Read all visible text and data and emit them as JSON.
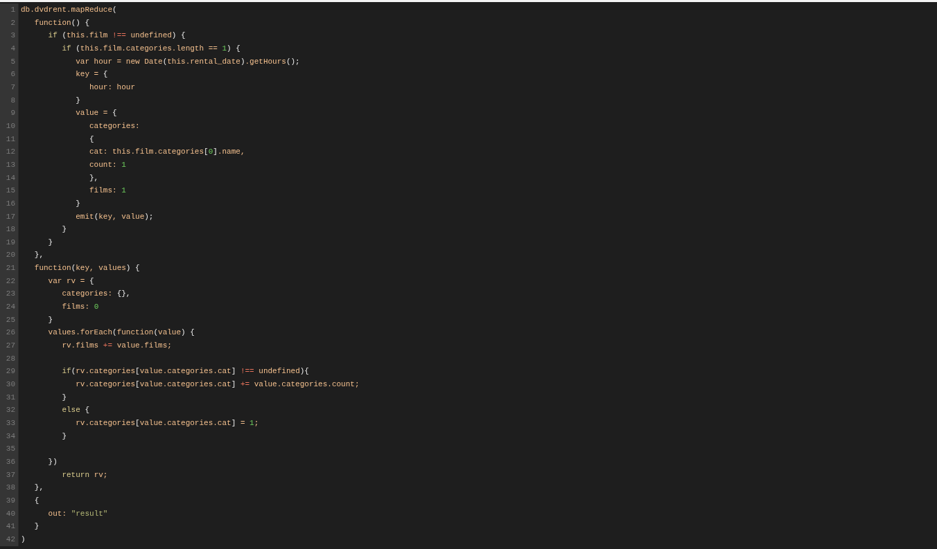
{
  "editor": {
    "lines": [
      {
        "number": "1",
        "tokens": [
          {
            "kind": "t",
            "text": "db.dvdrent.mapReduce"
          },
          {
            "kind": "p",
            "text": "("
          }
        ]
      },
      {
        "number": "2",
        "tokens": [
          {
            "kind": "t",
            "text": "   function"
          },
          {
            "kind": "p",
            "text": "() {"
          }
        ]
      },
      {
        "number": "3",
        "tokens": [
          {
            "kind": "k",
            "text": "      if"
          },
          {
            "kind": "p",
            "text": " ("
          },
          {
            "kind": "t",
            "text": "this.film "
          },
          {
            "kind": "o",
            "text": "!=="
          },
          {
            "kind": "t",
            "text": " undefined"
          },
          {
            "kind": "p",
            "text": ") {"
          }
        ]
      },
      {
        "number": "4",
        "tokens": [
          {
            "kind": "k",
            "text": "         if"
          },
          {
            "kind": "p",
            "text": " ("
          },
          {
            "kind": "t",
            "text": "this.film.categories.length == "
          },
          {
            "kind": "n",
            "text": "1"
          },
          {
            "kind": "p",
            "text": ") {"
          }
        ]
      },
      {
        "number": "5",
        "tokens": [
          {
            "kind": "t",
            "text": "            var hour = new Date"
          },
          {
            "kind": "p",
            "text": "("
          },
          {
            "kind": "t",
            "text": "this.rental_date"
          },
          {
            "kind": "p",
            "text": ")"
          },
          {
            "kind": "t",
            "text": ".getHours"
          },
          {
            "kind": "p",
            "text": "();"
          }
        ]
      },
      {
        "number": "6",
        "tokens": [
          {
            "kind": "t",
            "text": "            key = "
          },
          {
            "kind": "p",
            "text": "{"
          }
        ]
      },
      {
        "number": "7",
        "tokens": [
          {
            "kind": "t",
            "text": "               hour: hour"
          }
        ]
      },
      {
        "number": "8",
        "tokens": [
          {
            "kind": "p",
            "text": "            }"
          }
        ]
      },
      {
        "number": "9",
        "tokens": [
          {
            "kind": "t",
            "text": "            value = "
          },
          {
            "kind": "p",
            "text": "{"
          }
        ]
      },
      {
        "number": "10",
        "tokens": [
          {
            "kind": "t",
            "text": "               categories:"
          }
        ]
      },
      {
        "number": "11",
        "tokens": [
          {
            "kind": "p",
            "text": "               {"
          }
        ]
      },
      {
        "number": "12",
        "tokens": [
          {
            "kind": "t",
            "text": "               cat: this.film.categories"
          },
          {
            "kind": "p",
            "text": "["
          },
          {
            "kind": "n",
            "text": "0"
          },
          {
            "kind": "p",
            "text": "]"
          },
          {
            "kind": "t",
            "text": ".name,"
          }
        ]
      },
      {
        "number": "13",
        "tokens": [
          {
            "kind": "t",
            "text": "               count: "
          },
          {
            "kind": "n",
            "text": "1"
          }
        ]
      },
      {
        "number": "14",
        "tokens": [
          {
            "kind": "p",
            "text": "               },"
          }
        ]
      },
      {
        "number": "15",
        "tokens": [
          {
            "kind": "t",
            "text": "               films: "
          },
          {
            "kind": "n",
            "text": "1"
          }
        ]
      },
      {
        "number": "16",
        "tokens": [
          {
            "kind": "p",
            "text": "            }"
          }
        ]
      },
      {
        "number": "17",
        "tokens": [
          {
            "kind": "t",
            "text": "            emit"
          },
          {
            "kind": "p",
            "text": "("
          },
          {
            "kind": "t",
            "text": "key, value"
          },
          {
            "kind": "p",
            "text": ");"
          }
        ]
      },
      {
        "number": "18",
        "tokens": [
          {
            "kind": "p",
            "text": "         }"
          }
        ]
      },
      {
        "number": "19",
        "tokens": [
          {
            "kind": "p",
            "text": "      }"
          }
        ]
      },
      {
        "number": "20",
        "tokens": [
          {
            "kind": "p",
            "text": "   },"
          }
        ]
      },
      {
        "number": "21",
        "tokens": [
          {
            "kind": "t",
            "text": "   function"
          },
          {
            "kind": "p",
            "text": "("
          },
          {
            "kind": "t",
            "text": "key, values"
          },
          {
            "kind": "p",
            "text": ") {"
          }
        ]
      },
      {
        "number": "22",
        "tokens": [
          {
            "kind": "t",
            "text": "      var rv = "
          },
          {
            "kind": "p",
            "text": "{"
          }
        ]
      },
      {
        "number": "23",
        "tokens": [
          {
            "kind": "t",
            "text": "         categories: "
          },
          {
            "kind": "p",
            "text": "{},"
          }
        ]
      },
      {
        "number": "24",
        "tokens": [
          {
            "kind": "t",
            "text": "         films: "
          },
          {
            "kind": "n",
            "text": "0"
          }
        ]
      },
      {
        "number": "25",
        "tokens": [
          {
            "kind": "p",
            "text": "      }"
          }
        ]
      },
      {
        "number": "26",
        "tokens": [
          {
            "kind": "t",
            "text": "      values.forEach"
          },
          {
            "kind": "p",
            "text": "("
          },
          {
            "kind": "t",
            "text": "function"
          },
          {
            "kind": "p",
            "text": "("
          },
          {
            "kind": "t",
            "text": "value"
          },
          {
            "kind": "p",
            "text": ") {"
          }
        ]
      },
      {
        "number": "27",
        "tokens": [
          {
            "kind": "t",
            "text": "         rv.films "
          },
          {
            "kind": "o",
            "text": "+="
          },
          {
            "kind": "t",
            "text": " value.films;"
          }
        ]
      },
      {
        "number": "28"
      },
      {
        "number": "29",
        "tokens": [
          {
            "kind": "k",
            "text": "         if"
          },
          {
            "kind": "p",
            "text": "("
          },
          {
            "kind": "t",
            "text": "rv.categories"
          },
          {
            "kind": "p",
            "text": "["
          },
          {
            "kind": "t",
            "text": "value.categories.cat"
          },
          {
            "kind": "p",
            "text": "] "
          },
          {
            "kind": "o",
            "text": "!=="
          },
          {
            "kind": "t",
            "text": " undefined"
          },
          {
            "kind": "p",
            "text": "){"
          }
        ]
      },
      {
        "number": "30",
        "tokens": [
          {
            "kind": "t",
            "text": "            rv.categories"
          },
          {
            "kind": "p",
            "text": "["
          },
          {
            "kind": "t",
            "text": "value.categories.cat"
          },
          {
            "kind": "p",
            "text": "] "
          },
          {
            "kind": "o",
            "text": "+="
          },
          {
            "kind": "t",
            "text": " value.categories.count;"
          }
        ]
      },
      {
        "number": "31",
        "tokens": [
          {
            "kind": "p",
            "text": "         }"
          }
        ]
      },
      {
        "number": "32",
        "tokens": [
          {
            "kind": "k",
            "text": "         else"
          },
          {
            "kind": "p",
            "text": " {"
          }
        ]
      },
      {
        "number": "33",
        "tokens": [
          {
            "kind": "t",
            "text": "            rv.categories"
          },
          {
            "kind": "p",
            "text": "["
          },
          {
            "kind": "t",
            "text": "value.categories.cat"
          },
          {
            "kind": "p",
            "text": "] "
          },
          {
            "kind": "t",
            "text": "= "
          },
          {
            "kind": "n",
            "text": "1"
          },
          {
            "kind": "t",
            "text": ";"
          }
        ]
      },
      {
        "number": "34",
        "tokens": [
          {
            "kind": "p",
            "text": "         }"
          }
        ]
      },
      {
        "number": "35"
      },
      {
        "number": "36",
        "tokens": [
          {
            "kind": "p",
            "text": "      })"
          }
        ]
      },
      {
        "number": "37",
        "tokens": [
          {
            "kind": "k",
            "text": "         return"
          },
          {
            "kind": "t",
            "text": " rv;"
          }
        ]
      },
      {
        "number": "38",
        "tokens": [
          {
            "kind": "p",
            "text": "   },"
          }
        ]
      },
      {
        "number": "39",
        "tokens": [
          {
            "kind": "p",
            "text": "   {"
          }
        ]
      },
      {
        "number": "40",
        "tokens": [
          {
            "kind": "t",
            "text": "      out: "
          },
          {
            "kind": "s",
            "text": "\"result\""
          }
        ]
      },
      {
        "number": "41",
        "tokens": [
          {
            "kind": "p",
            "text": "   }"
          }
        ]
      },
      {
        "number": "42",
        "tokens": [
          {
            "kind": "p",
            "text": ")"
          }
        ]
      }
    ]
  }
}
